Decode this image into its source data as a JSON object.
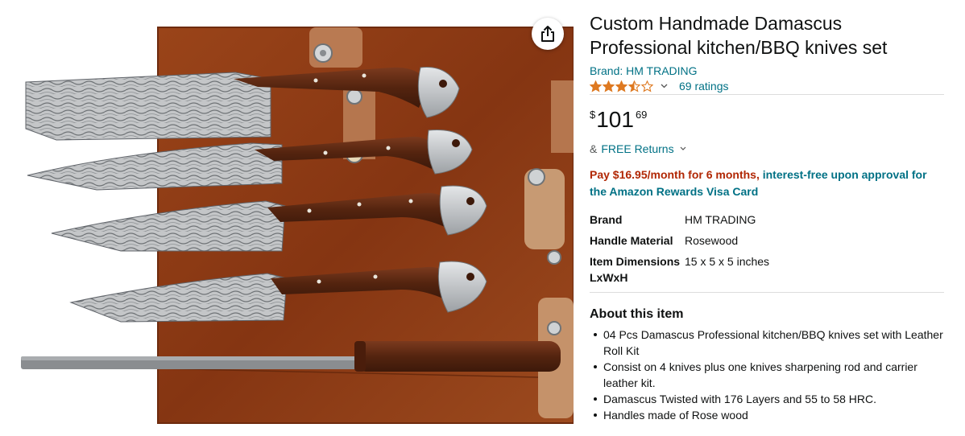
{
  "product": {
    "title": "Custom Handmade Damascus Professional kitchen/BBQ knives set",
    "brand_link": "Brand: HM TRADING",
    "rating": {
      "stars": 3.5,
      "max_stars": 5,
      "count_label": "69 ratings"
    },
    "price": {
      "symbol": "$",
      "whole": "101",
      "fraction": "69"
    },
    "returns": {
      "prefix": "&",
      "label": "FREE Returns"
    },
    "financing": {
      "offer": "Pay $16.95/month for 6 months",
      "separator": ",",
      "terms": " interest-free upon approval for the Amazon Rewards Visa Card"
    },
    "specs": [
      {
        "label": "Brand",
        "value": "HM TRADING"
      },
      {
        "label": "Handle Material",
        "value": "Rosewood"
      },
      {
        "label": "Item Dimensions LxWxH",
        "value": "15 x 5 x 5 inches"
      }
    ],
    "about": {
      "heading": "About this item",
      "bullets": [
        "04 Pcs Damascus Professional kitchen/BBQ knives set with Leather Roll Kit",
        "Consist on 4 knives plus one knives sharpening rod and carrier leather kit.",
        "Damascus Twisted with 176 Layers and 55 to 58 HRC.",
        "Handles made of Rose wood"
      ]
    }
  },
  "icons": {
    "share": "share-icon",
    "star_full": "star-full-icon",
    "star_half": "star-half-icon",
    "star_empty": "star-empty-icon",
    "chevron": "chevron-down-icon"
  },
  "colors": {
    "link": "#007185",
    "star": "#de7921",
    "offer": "#b12704",
    "text": "#0f1111",
    "leather": "#8b3a17",
    "handle": "#5b2714",
    "steel": "#b9bcbf",
    "divider": "#dddddd"
  }
}
